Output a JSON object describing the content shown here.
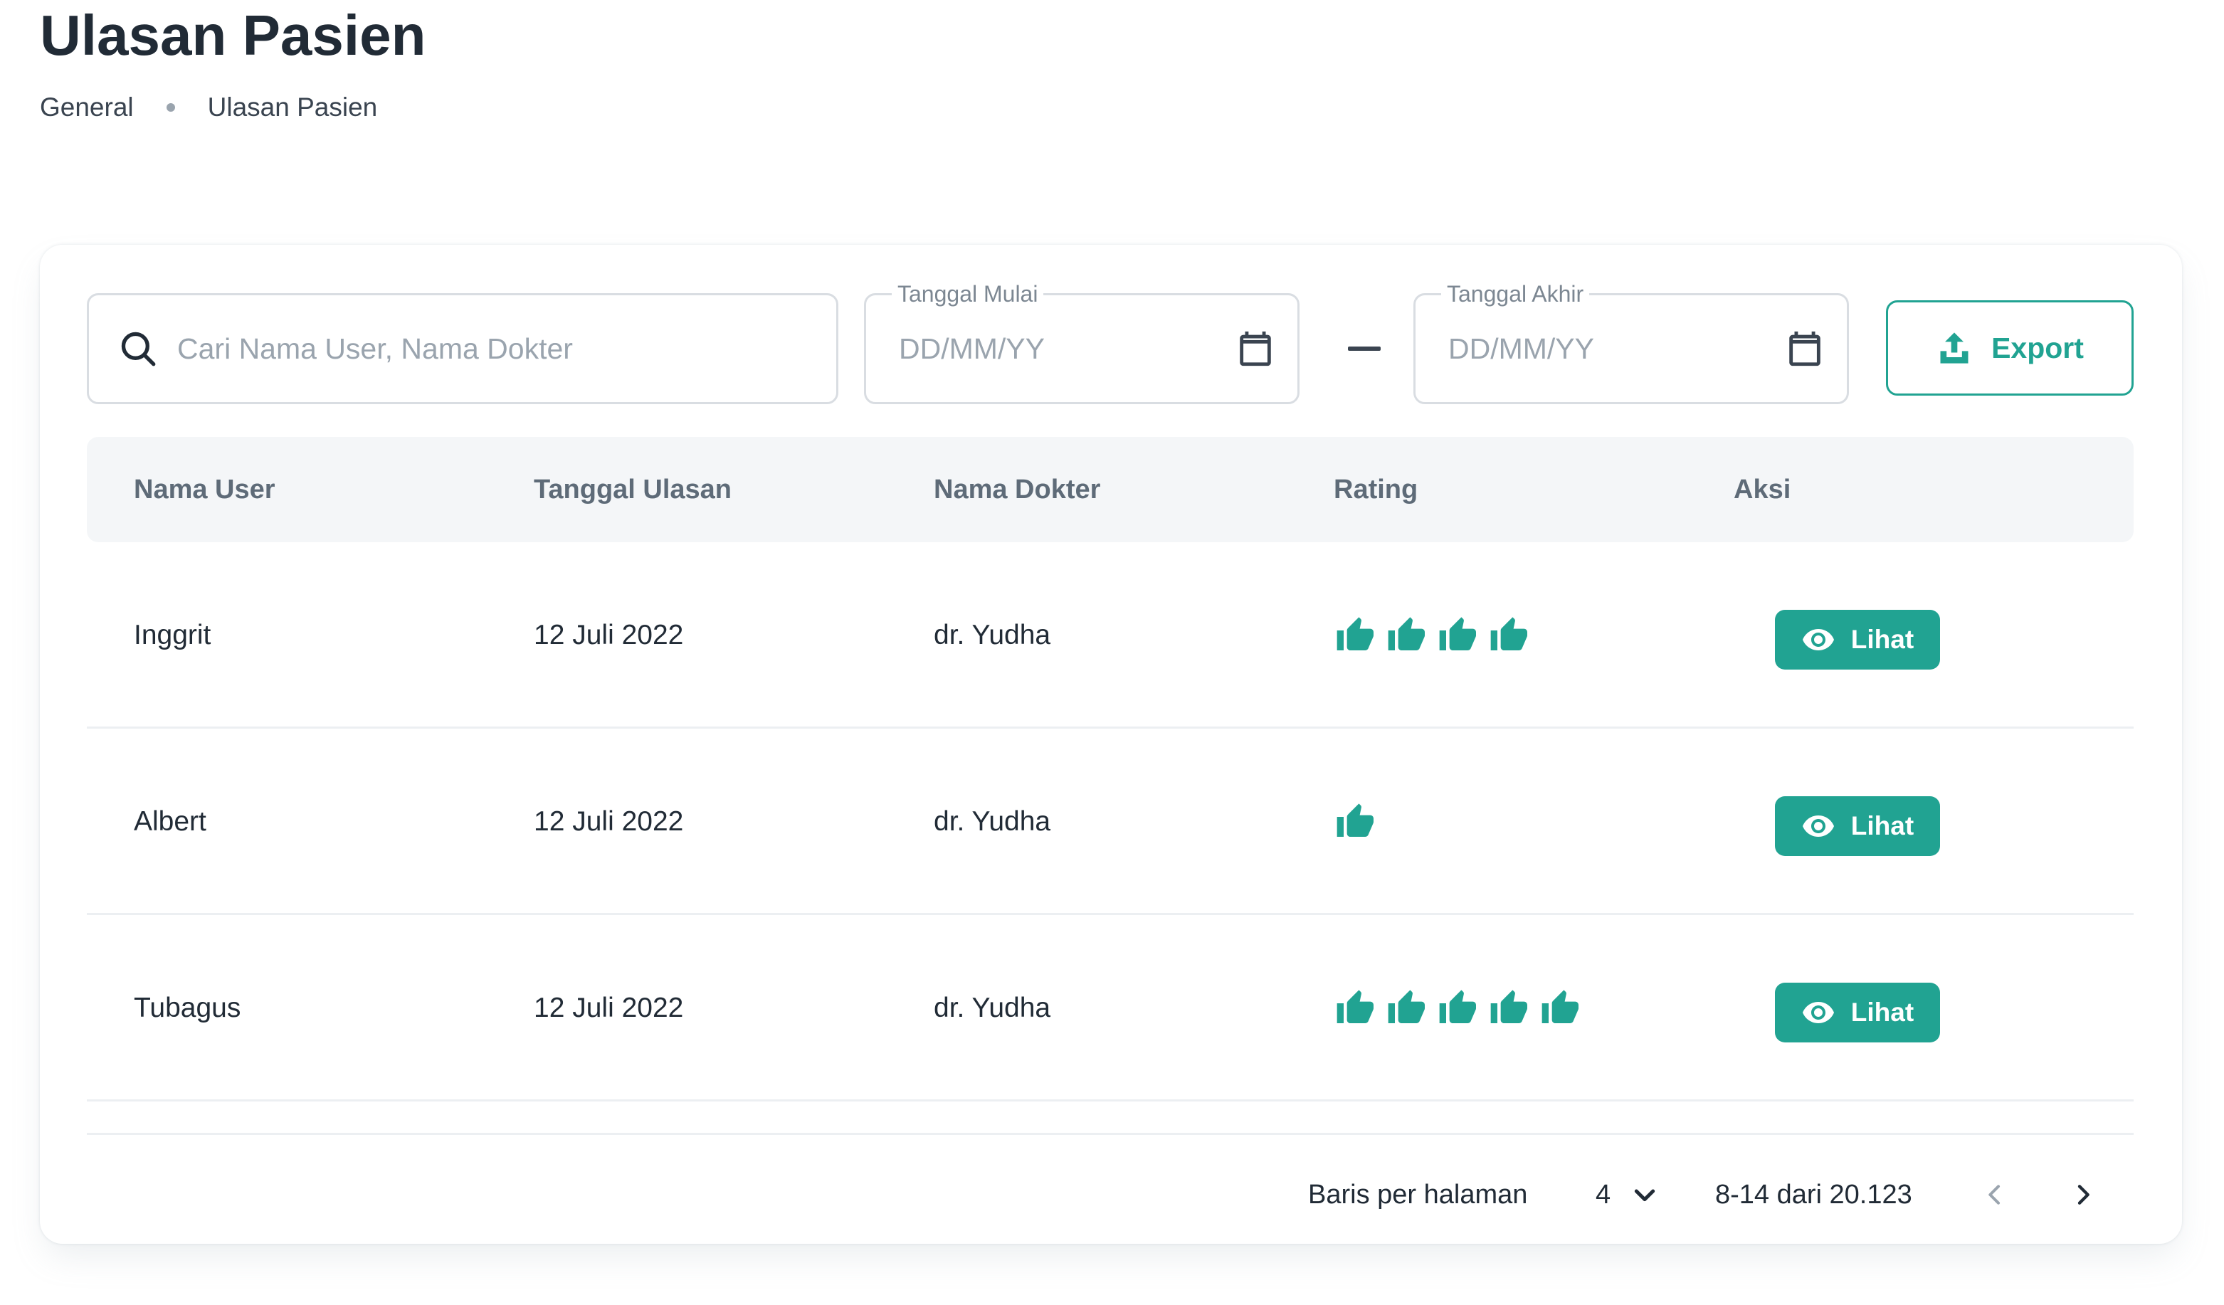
{
  "page": {
    "title": "Ulasan Pasien",
    "breadcrumb": [
      "General",
      "Ulasan Pasien"
    ]
  },
  "filters": {
    "search_placeholder": "Cari Nama User, Nama Dokter",
    "start_date_label": "Tanggal Mulai",
    "start_date_placeholder": "DD/MM/YY",
    "end_date_label": "Tanggal Akhir",
    "end_date_placeholder": "DD/MM/YY",
    "export_label": "Export"
  },
  "table": {
    "columns": [
      "Nama User",
      "Tanggal Ulasan",
      "Nama Dokter",
      "Rating",
      "Aksi"
    ],
    "rows": [
      {
        "user": "Inggrit",
        "date": "12 Juli 2022",
        "doctor": "dr. Yudha",
        "rating": 4,
        "action": "Lihat"
      },
      {
        "user": "Albert",
        "date": "12 Juli 2022",
        "doctor": "dr. Yudha",
        "rating": 1,
        "action": "Lihat"
      },
      {
        "user": "Tubagus",
        "date": "12 Juli 2022",
        "doctor": "dr. Yudha",
        "rating": 5,
        "action": "Lihat"
      }
    ]
  },
  "pagination": {
    "rows_per_page_label": "Baris per halaman",
    "rows_per_page_value": "4",
    "range_text": "8-14 dari 20.123"
  },
  "colors": {
    "accent": "#21a392",
    "text": "#212b36",
    "muted": "#9aa4ae",
    "header_bg": "#f4f6f8"
  },
  "icons": {
    "search": "search-icon",
    "calendar": "calendar-icon",
    "export": "upload-icon",
    "rating": "thumbs-up-icon",
    "view": "eye-icon",
    "dropdown": "chevron-down-icon",
    "prev": "chevron-left-icon",
    "next": "chevron-right-icon"
  }
}
